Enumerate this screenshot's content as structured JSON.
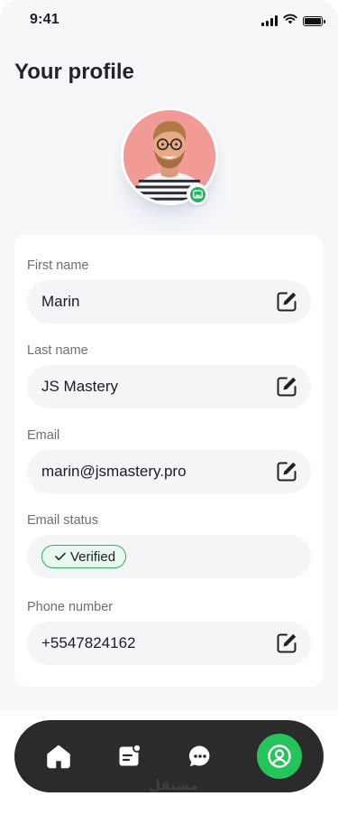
{
  "status_bar": {
    "time": "9:41"
  },
  "page": {
    "title": "Your profile"
  },
  "avatar": {
    "background_color": "#f29a96",
    "edit_icon": "image-edit-icon"
  },
  "fields": [
    {
      "label": "First name",
      "value": "Marin",
      "icon": "edit-icon"
    },
    {
      "label": "Last name",
      "value": "JS Mastery",
      "icon": "edit-icon"
    },
    {
      "label": "Email",
      "value": "marin@jsmastery.pro",
      "icon": "edit-icon"
    },
    {
      "label": "Email status",
      "badge": "Verified",
      "badge_color": "#2cb463"
    },
    {
      "label": "Phone number",
      "value": "+5547824162",
      "icon": "edit-icon"
    }
  ],
  "bottom_nav": {
    "items": [
      {
        "icon": "home-icon",
        "active": false
      },
      {
        "icon": "notes-icon",
        "active": false
      },
      {
        "icon": "chat-icon",
        "active": false
      },
      {
        "icon": "profile-icon",
        "active": true
      }
    ],
    "accent": "#24c45b",
    "background": "#2b2b2b"
  },
  "watermark": "مستقل"
}
